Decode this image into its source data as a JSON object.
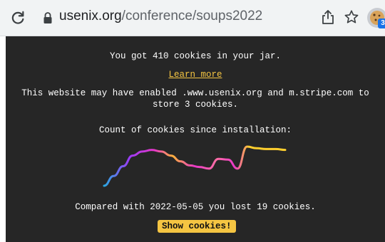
{
  "browser": {
    "url_domain": "usenix.org",
    "url_path": "/conference/soups2022",
    "extension_badge": "3"
  },
  "popup": {
    "cookie_summary": "You got 410 cookies in your jar.",
    "learn_more": "Learn more",
    "sites_line1": "This website may have enabled .www.usenix.org and m.stripe.com to",
    "sites_line2": "store 3 cookies.",
    "chart_caption": "Count of cookies since installation:",
    "comparison": "Compared with 2022-05-05 you lost 19 cookies.",
    "show_button": "Show cookies!"
  },
  "colors": {
    "panel_bg": "#262626",
    "accent": "#f5c542",
    "gradient": [
      "#2aa8e0",
      "#9b3bf5",
      "#e837c8",
      "#ffcf2e"
    ]
  },
  "chart_data": {
    "type": "line",
    "title": "",
    "xlabel": "",
    "ylabel": "",
    "grid": false,
    "series": [
      {
        "values": [
          380,
          392,
          404,
          417,
          422,
          424,
          422,
          417,
          410,
          405,
          403,
          401,
          413,
          412,
          401,
          428,
          426,
          425,
          425,
          424
        ]
      }
    ]
  }
}
